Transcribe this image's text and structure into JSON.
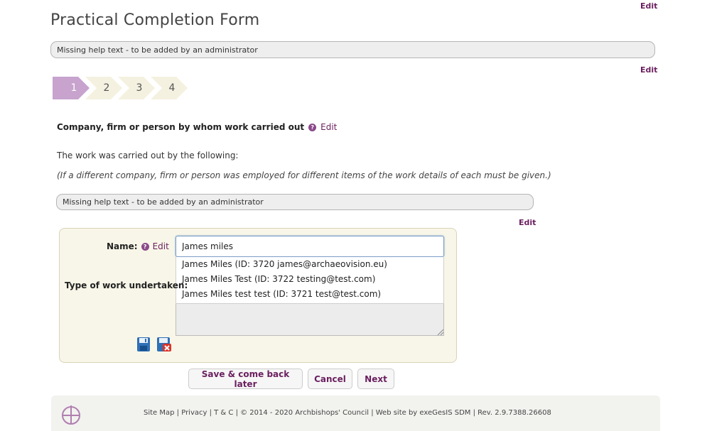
{
  "header": {
    "top_edit": "Edit",
    "title": "Practical Completion Form",
    "help_text": "Missing help text - to be added by an administrator",
    "help_edit": "Edit"
  },
  "steps": [
    {
      "label": "1",
      "active": true
    },
    {
      "label": "2",
      "active": false
    },
    {
      "label": "3",
      "active": false
    },
    {
      "label": "4",
      "active": false
    }
  ],
  "section": {
    "heading": "Company, firm or person by whom work carried out",
    "heading_edit": "Edit",
    "intro": "The work was carried out by the following:",
    "note": "(If a different company, firm or person was employed for different items of the work details of each must be given.)",
    "help_text": "Missing help text - to be added by an administrator",
    "help_edit": "Edit"
  },
  "form": {
    "name_label": "Name:",
    "name_edit": "Edit",
    "name_value": "James miles",
    "autocomplete": [
      "James Miles (ID: 3720 james@archaeovision.eu)",
      "James Miles Test (ID: 3722 testing@test.com)",
      "James Miles test test (ID: 3721 test@test.com)"
    ],
    "work_label": "Type of work undertaken:",
    "work_value": ""
  },
  "buttons": {
    "save_later": "Save & come back later",
    "cancel": "Cancel",
    "next": "Next"
  },
  "footer": {
    "text": "Site Map | Privacy | T & C | © 2014 - 2020 Archbishops' Council | Web site by exeGesIS SDM | Rev. 2.9.7388.26608"
  },
  "colors": {
    "accent": "#6a1f5f",
    "step_active": "#c7a3cd",
    "step_inactive": "#f4f1e0",
    "panel_bg": "#f8f6e8"
  }
}
